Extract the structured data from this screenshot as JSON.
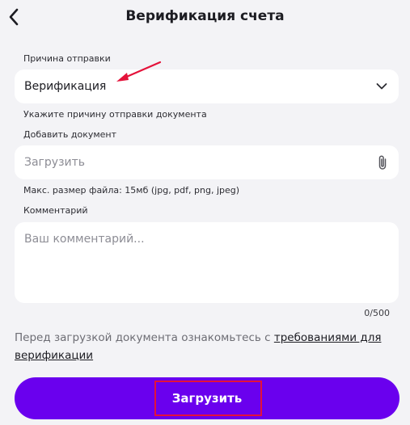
{
  "header": {
    "title": "Верификация счета",
    "back_icon": "chevron-left-icon"
  },
  "reason": {
    "label": "Причина отправки",
    "value": "Верификация",
    "hint": "Укажите причину отправки документа",
    "icon": "chevron-down-icon"
  },
  "document": {
    "label": "Добавить документ",
    "placeholder": "Загрузить",
    "hint": "Макс. размер файла: 15мб (jpg, pdf, png, jpeg)",
    "icon": "paperclip-icon"
  },
  "comment": {
    "label": "Комментарий",
    "placeholder": "Ваш комментарий...",
    "counter": "0/500"
  },
  "notice": {
    "text": "Перед загрузкой документа ознакомьтесь с ",
    "link": "требованиями для верификации"
  },
  "submit": {
    "label": "Загрузить"
  },
  "colors": {
    "background": "#f3f3f6",
    "accent": "#6a00ee",
    "annotation": "#e4123a"
  }
}
